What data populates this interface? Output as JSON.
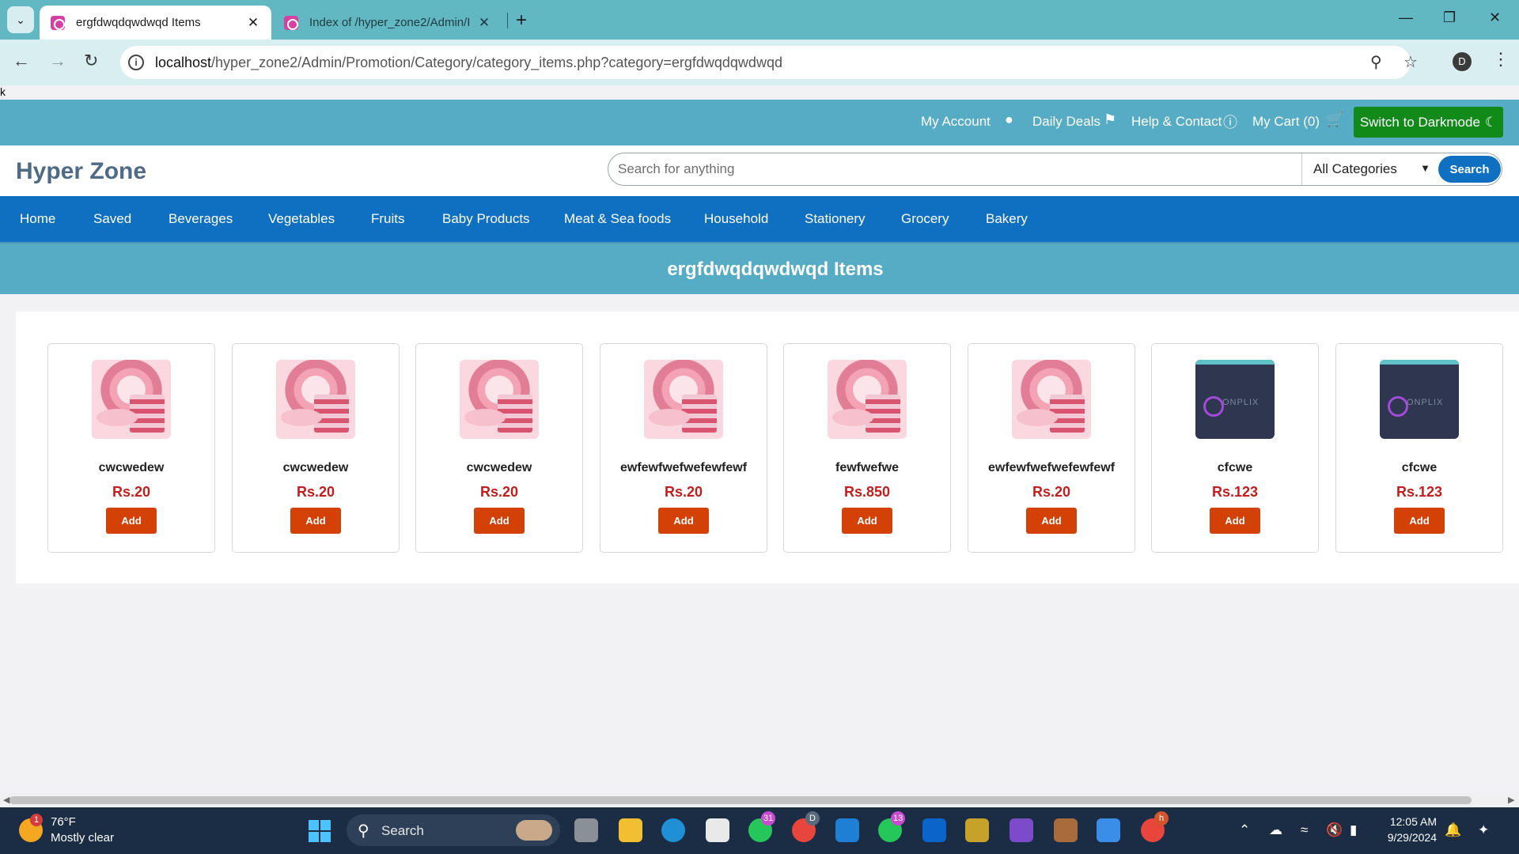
{
  "browser": {
    "tabs": [
      {
        "title": "ergfdwqdqwdwqd Items",
        "active": true
      },
      {
        "title": "Index of /hyper_zone2/Admin/I",
        "active": false
      }
    ],
    "url_host": "localhost",
    "url_path": "/hyper_zone2/Admin/Promotion/Category/category_items.php?category=ergfdwqdqwdwqd",
    "profile_initial": "D"
  },
  "page": {
    "stray_text": "k",
    "topbar": {
      "my_account": "My Account",
      "daily_deals": "Daily Deals",
      "help_contact": "Help & Contact",
      "my_cart": "My Cart (0)",
      "darkmode": "Switch to Darkmode"
    },
    "header": {
      "logo": "Hyper Zone",
      "search_placeholder": "Search for anything",
      "category_selected": "All Categories",
      "search_button": "Search"
    },
    "nav": [
      "Home",
      "Saved",
      "Beverages",
      "Vegetables",
      "Fruits",
      "Baby Products",
      "Meat & Sea foods",
      "Household",
      "Stationery",
      "Grocery",
      "Bakery"
    ],
    "banner_title": "ergfdwqdqwdwqd Items",
    "products": [
      {
        "name": "cwcwedew",
        "price": "Rs.20",
        "image": "cake",
        "add": "Add"
      },
      {
        "name": "cwcwedew",
        "price": "Rs.20",
        "image": "cake",
        "add": "Add"
      },
      {
        "name": "cwcwedew",
        "price": "Rs.20",
        "image": "cake",
        "add": "Add"
      },
      {
        "name": "ewfewfwefwefewfewf",
        "price": "Rs.20",
        "image": "cake",
        "add": "Add"
      },
      {
        "name": "fewfwefwe",
        "price": "Rs.850",
        "image": "cake",
        "add": "Add"
      },
      {
        "name": "ewfewfwefwefewfewf",
        "price": "Rs.20",
        "image": "cake",
        "add": "Add"
      },
      {
        "name": "cfcwe",
        "price": "Rs.123",
        "image": "onplix",
        "add": "Add"
      },
      {
        "name": "cfcwe",
        "price": "Rs.123",
        "image": "onplix",
        "add": "Add"
      }
    ]
  },
  "taskbar": {
    "weather_temp": "76°F",
    "weather_desc": "Mostly clear",
    "weather_badge": "1",
    "search_label": "Search",
    "badges": {
      "whatsapp": "31",
      "chrome_profile": "D",
      "whatsapp2": "13",
      "chrome_h": "h"
    },
    "time": "12:05 AM",
    "date": "9/29/2024"
  },
  "colors": {
    "tab_strip": "#62b8c2",
    "topbar": "#56acc4",
    "navbar": "#0f6fc1",
    "darkmode_button": "#118a1a",
    "price": "#c41d1d",
    "add_button": "#d44106"
  }
}
